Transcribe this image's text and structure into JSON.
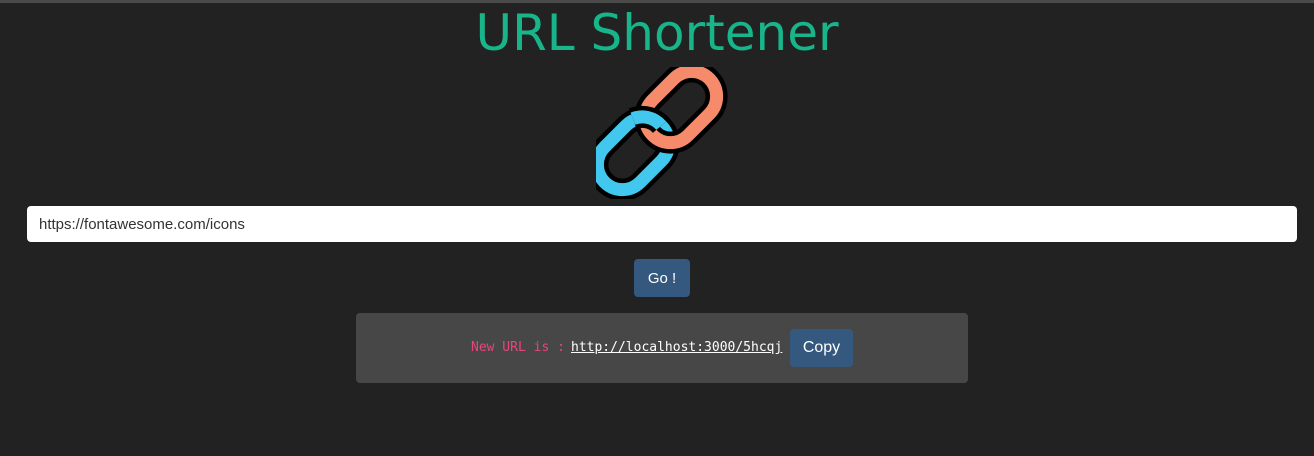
{
  "header": {
    "title": "URL Shortener",
    "logo_icon": "link-icon",
    "colors": {
      "title": "#18b48a",
      "link_left": "#42c8ee",
      "link_right": "#f68b6b"
    }
  },
  "form": {
    "url_value": "https://fontawesome.com/icons",
    "go_label": "Go !"
  },
  "result": {
    "label": "New URL is :",
    "short_url": "http://localhost:3000/5hcqj",
    "copy_label": "Copy",
    "colors": {
      "label": "#e8457c",
      "button": "#35587f"
    }
  }
}
